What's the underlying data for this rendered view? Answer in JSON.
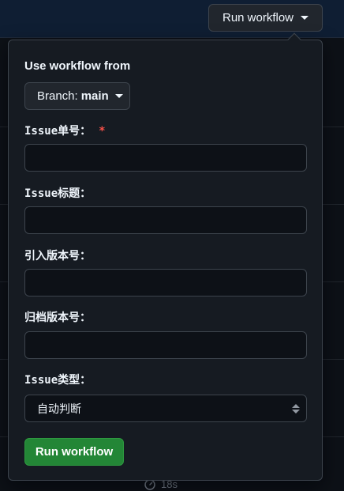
{
  "trigger": {
    "label": "Run workflow"
  },
  "popover": {
    "use_from_label": "Use workflow from",
    "branch": {
      "prefix": "Branch:",
      "name": "main"
    },
    "fields": [
      {
        "label": "Issue单号：",
        "required": "*",
        "value": "",
        "placeholder": ""
      },
      {
        "label": "Issue标题：",
        "value": "",
        "placeholder": ""
      },
      {
        "label": "引入版本号：",
        "value": "",
        "placeholder": ""
      },
      {
        "label": "归档版本号：",
        "value": "",
        "placeholder": ""
      }
    ],
    "type_field": {
      "label": "Issue类型：",
      "selected": "自动判断"
    },
    "submit_label": "Run workflow"
  },
  "background": {
    "duration": "18s"
  },
  "colors": {
    "accent_green": "#238636",
    "required_red": "#f85149",
    "surface": "#161b22",
    "border": "#3d444d"
  }
}
